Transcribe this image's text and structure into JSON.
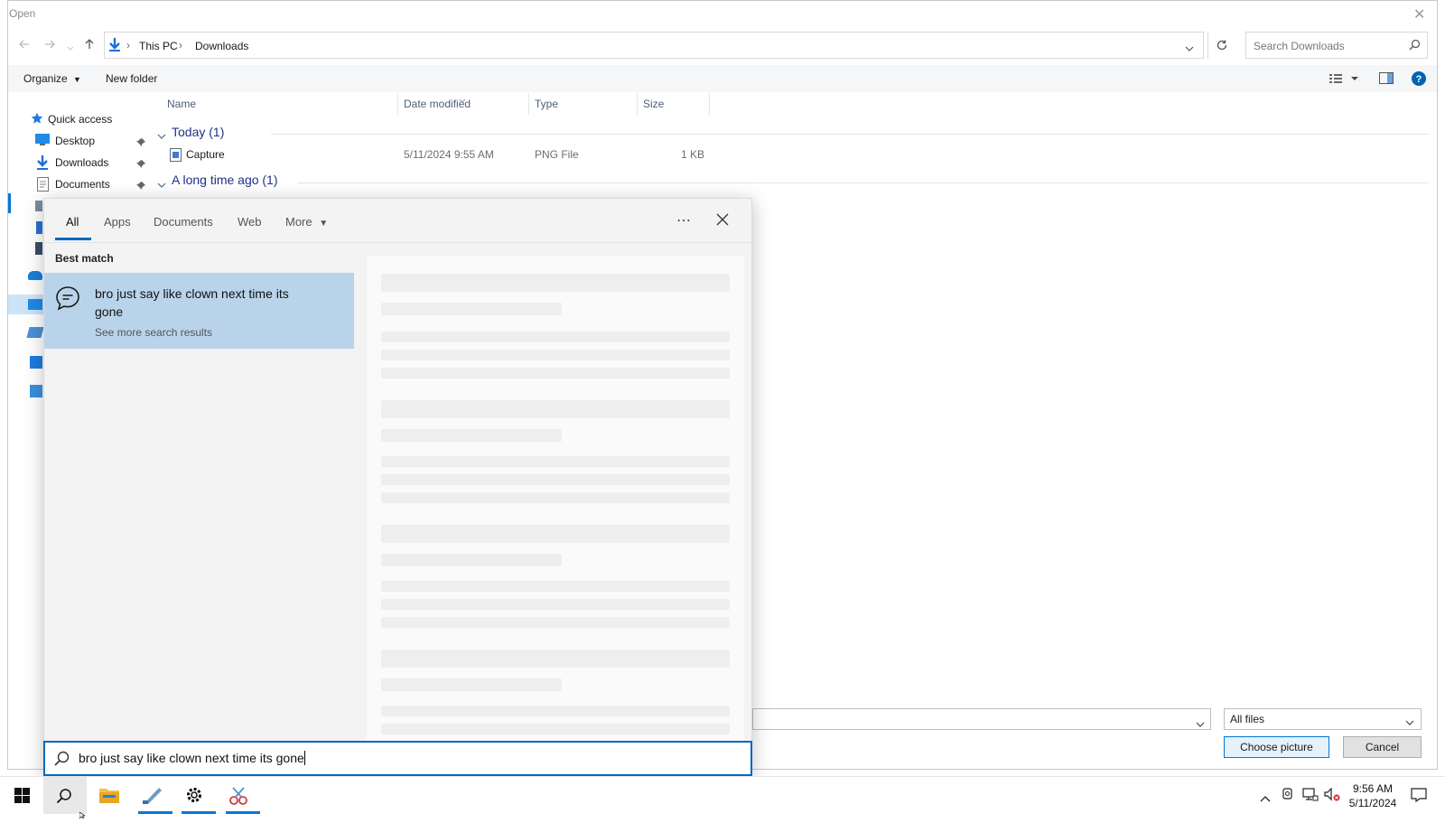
{
  "dialog": {
    "title": "Open",
    "close_glyph": "✕"
  },
  "address": {
    "segments": [
      "This PC",
      "Downloads"
    ],
    "separator": "›",
    "search_placeholder": "Search Downloads"
  },
  "toolbar": {
    "organize": "Organize",
    "new_folder": "New folder"
  },
  "columns": {
    "name": "Name",
    "date": "Date modified",
    "type": "Type",
    "size": "Size"
  },
  "nav": {
    "quick_access": "Quick access",
    "items": [
      "Desktop",
      "Downloads",
      "Documents"
    ]
  },
  "files": {
    "group_today": "Today (1)",
    "file_name": "Capture",
    "file_date": "5/11/2024 9:55 AM",
    "file_type": "PNG File",
    "file_size": "1 KB",
    "group_old": "A long time ago (1)"
  },
  "bottom": {
    "filetype_value": "All files",
    "choose_label": "Choose picture",
    "cancel_label": "Cancel"
  },
  "flyout": {
    "tabs": [
      "All",
      "Apps",
      "Documents",
      "Web",
      "More"
    ],
    "more_icon": "⋯",
    "best_match_label": "Best match",
    "result_title": "bro just say like clown next time its gone",
    "result_sub": "See more search results",
    "search_value": "bro just say like clown next time its gone"
  },
  "taskbar": {
    "time": "9:56 AM",
    "date": "5/11/2024"
  },
  "colors": {
    "accent": "#0067c0",
    "selected_result": "#b9d4ea",
    "group_header": "#1e3287"
  }
}
